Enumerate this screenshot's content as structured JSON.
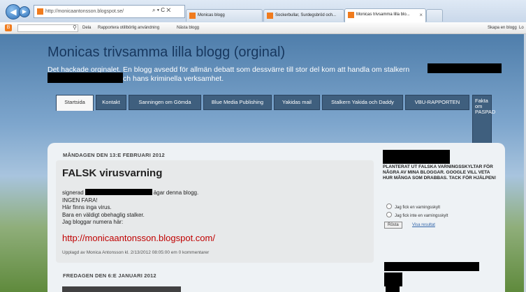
{
  "browser": {
    "address": "http://monicaantonsson.blogspot.se/",
    "addr_controls": "⌕ ▾ C ✕",
    "tabs": [
      {
        "label": "Monicas blogg"
      },
      {
        "label": "Sockerbullar, Surdegsbröd och..."
      },
      {
        "label": "Monicas trivsamma lilla blo...",
        "close": "×"
      }
    ]
  },
  "blogger_bar": {
    "links": [
      "Dela",
      "Rapportera otillbörlig användning",
      "Nästa blogg"
    ],
    "right": [
      "Skapa en blogg",
      "Lo"
    ]
  },
  "blog": {
    "title": "Monicas trivsamma lilla blogg (orginal)",
    "desc_line1": "Det hackade orginalet. En blogg avsedd för allmän debatt som dessvärre till stor del kom att handla om stalkern",
    "desc_line2": "ch hans kriminella verksamhet."
  },
  "page_tabs": [
    "Startsida",
    "Kontakt",
    "Sanningen om Gömda",
    "Blue Media Publishing",
    "Yakidas mail",
    "Stalkern Yakida och Daddy",
    "VBU-RAPPORTEN",
    "Fakta om PASPAD"
  ],
  "post": {
    "date": "MÅNDAGEN DEN 13:E FEBRUARI 2012",
    "title": "FALSK virusvarning",
    "line1_pre": "signerad",
    "line1_post": "ägar denna blogg.",
    "lines": [
      "INGEN FARA!",
      "Här finns inga virus.",
      "Bara en väldigt obehaglig stalker.",
      "Jag bloggar numera här:"
    ],
    "link": "http://monicaantonsson.blogspot.com/",
    "footer": "Upplagd av Monica Antonsson kl. 2/13/2012 08:05:00 em    0 kommentarer"
  },
  "next_post": {
    "date": "FREDAGEN DEN 6:E JANUARI 2012"
  },
  "poll": {
    "question": "PLANTERAT UT FALSKA VARNINGSSKYLTAR FÖR NÅGRA AV MINA BLOGGAR. GOOGLE VILL VETA HUR MÅNGA SOM DRABBAS. TACK FÖR HJÄLPEN!",
    "options": [
      "Jag fick en varningsskylt",
      "Jag fick inte en varningsskylt"
    ],
    "vote": "Rösta",
    "results": "Visa resultat"
  },
  "colors": {
    "title": "#17375e",
    "link": "#c00000",
    "tab": "#3f5f7e"
  }
}
